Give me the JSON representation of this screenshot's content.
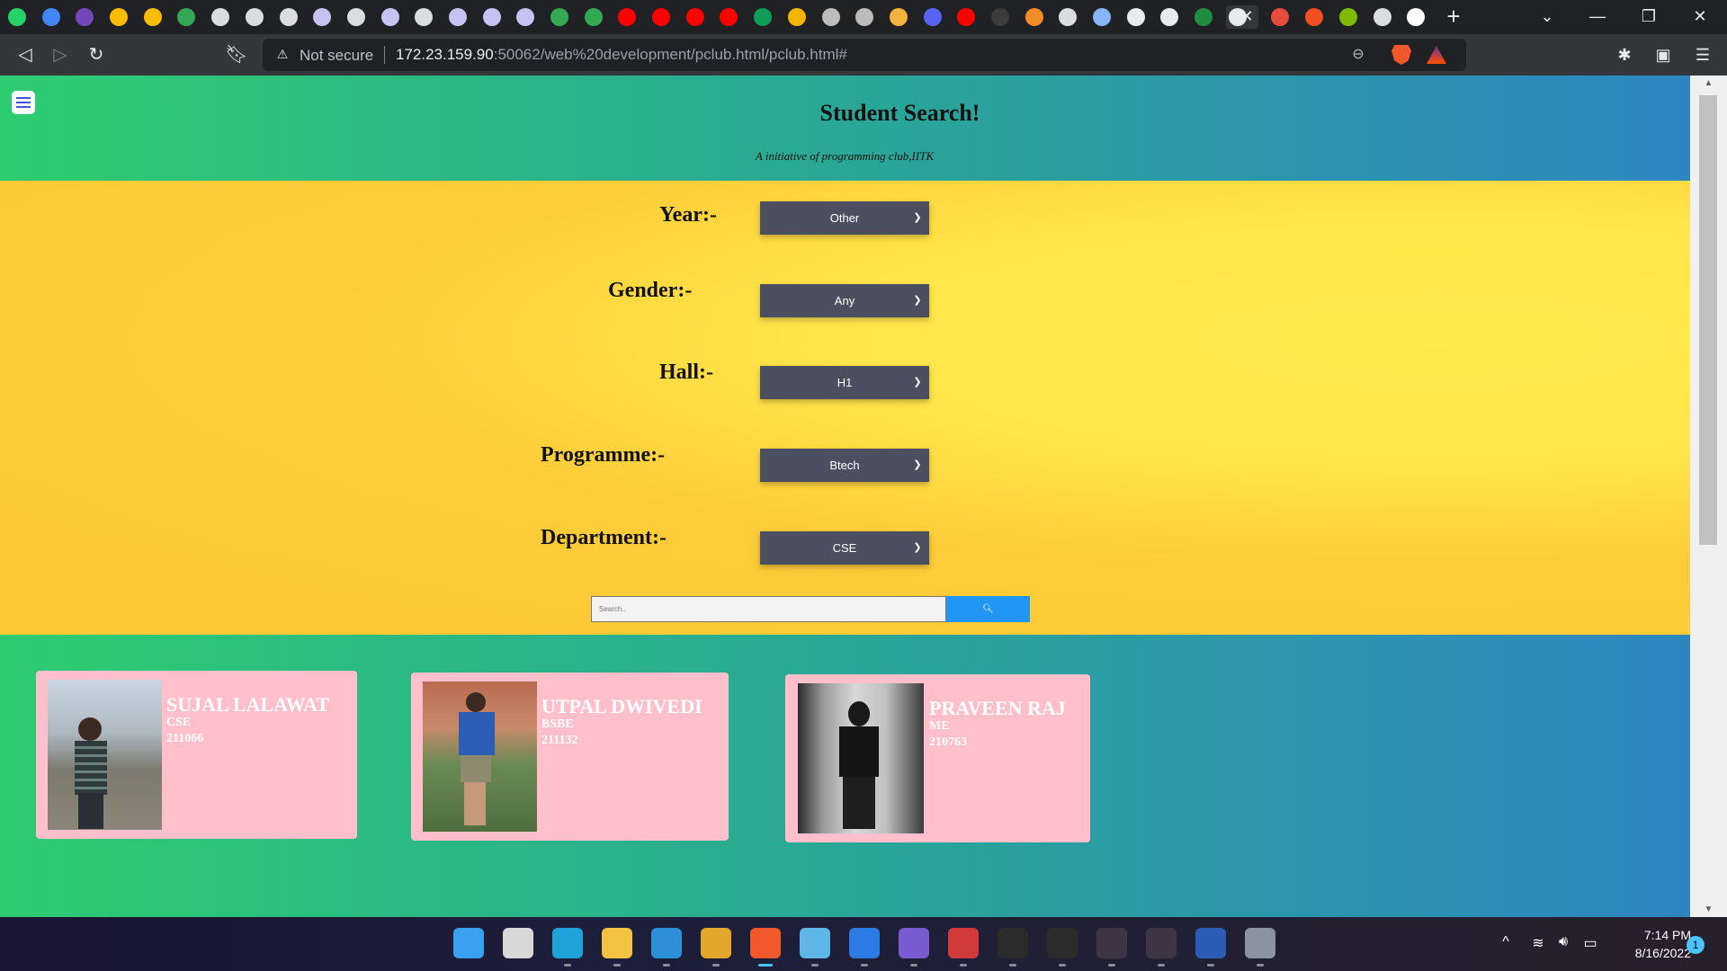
{
  "browser": {
    "address_bar": {
      "security_label": "Not secure",
      "url_host": "172.23.159.90",
      "url_path": ":50062/web%20development/pclub.html/pclub.html#"
    },
    "tab_icons": [
      {
        "name": "whatsapp-icon",
        "color": "#25d366"
      },
      {
        "name": "docs-icon",
        "color": "#4285f4"
      },
      {
        "name": "forms-icon",
        "color": "#7248b9"
      },
      {
        "name": "drive-icon",
        "color": "#fbbc04"
      },
      {
        "name": "drive-icon",
        "color": "#fbbc04"
      },
      {
        "name": "drive-icon",
        "color": "#34a853"
      },
      {
        "name": "globe-icon",
        "color": "#dadce0"
      },
      {
        "name": "globe-icon",
        "color": "#dadce0"
      },
      {
        "name": "globe-icon",
        "color": "#dadce0"
      },
      {
        "name": "page-icon",
        "color": "#c5c3f2"
      },
      {
        "name": "globe-icon",
        "color": "#dadce0"
      },
      {
        "name": "page-icon",
        "color": "#c5c3f2"
      },
      {
        "name": "globe-icon",
        "color": "#dadce0"
      },
      {
        "name": "page-icon",
        "color": "#c5c3f2"
      },
      {
        "name": "page-icon",
        "color": "#c5c3f2"
      },
      {
        "name": "page-icon",
        "color": "#c5c3f2"
      },
      {
        "name": "drive-icon",
        "color": "#34a853"
      },
      {
        "name": "drive-icon",
        "color": "#34a853"
      },
      {
        "name": "youtube-icon",
        "color": "#ff0000"
      },
      {
        "name": "youtube-icon",
        "color": "#ff0000"
      },
      {
        "name": "youtube-icon",
        "color": "#ff0000"
      },
      {
        "name": "youtube-icon",
        "color": "#ff0000"
      },
      {
        "name": "sheets-plus-icon",
        "color": "#0f9d58"
      },
      {
        "name": "in-icon",
        "color": "#f4b400"
      },
      {
        "name": "cc-icon",
        "color": "#bdbdbd"
      },
      {
        "name": "cc-icon",
        "color": "#bdbdbd"
      },
      {
        "name": "globe-color-icon",
        "color": "#f3b23b"
      },
      {
        "name": "copilot-icon",
        "color": "#5865f2"
      },
      {
        "name": "youtube-icon",
        "color": "#ff0000"
      },
      {
        "name": "bug-icon",
        "color": "#3c3c3c"
      },
      {
        "name": "diamond-icon",
        "color": "#f28c28"
      },
      {
        "name": "globe-icon",
        "color": "#dadce0"
      },
      {
        "name": "gear-icon",
        "color": "#8ab4f8"
      },
      {
        "name": "shield-icon",
        "color": "#e8eaed"
      },
      {
        "name": "download-icon",
        "color": "#e8eaed"
      },
      {
        "name": "box-download-icon",
        "color": "#1e8e3e"
      },
      {
        "name": "active-tab-icon",
        "color": "#e8eaed"
      },
      {
        "name": "shield-red-icon",
        "color": "#e94b3c"
      },
      {
        "name": "microsoft-icon",
        "color": "#f25022"
      },
      {
        "name": "microsoft-icon",
        "color": "#7fba00"
      },
      {
        "name": "globe-icon",
        "color": "#dadce0"
      },
      {
        "name": "github-icon",
        "color": "#ffffff"
      }
    ]
  },
  "page": {
    "title": "Student Search!",
    "subtitle": "A initiative of programming club,IITK",
    "filters": {
      "year": {
        "label": "Year:-",
        "value": "Other"
      },
      "gender": {
        "label": "Gender:-",
        "value": "Any"
      },
      "hall": {
        "label": "Hall:-",
        "value": "H1"
      },
      "programme": {
        "label": "Programme:-",
        "value": "Btech"
      },
      "department": {
        "label": "Department:-",
        "value": "CSE"
      }
    },
    "search": {
      "placeholder": "Search.."
    },
    "students": [
      {
        "name": "SUJAL LALAWAT",
        "dept": "CSE",
        "roll": "211066"
      },
      {
        "name": "UTPAL DWIVEDI",
        "dept": "BSBE",
        "roll": "211132"
      },
      {
        "name": "PRAVEEN RAJ",
        "dept": "ME",
        "roll": "210763"
      }
    ]
  },
  "taskbar": {
    "apps": [
      "windows-start-icon",
      "search-icon",
      "edge-icon",
      "file-explorer-icon",
      "vscode-icon",
      "chrome-icon",
      "brave-icon",
      "notepad-icon",
      "h-app-icon",
      "photos-icon",
      "media-app-icon",
      "terminal-icon",
      "terminal-icon",
      "bug-icon",
      "bug-icon",
      "word-icon",
      "settings-icon"
    ],
    "time": "7:14 PM",
    "date": "8/16/2022",
    "notifications": "1"
  }
}
